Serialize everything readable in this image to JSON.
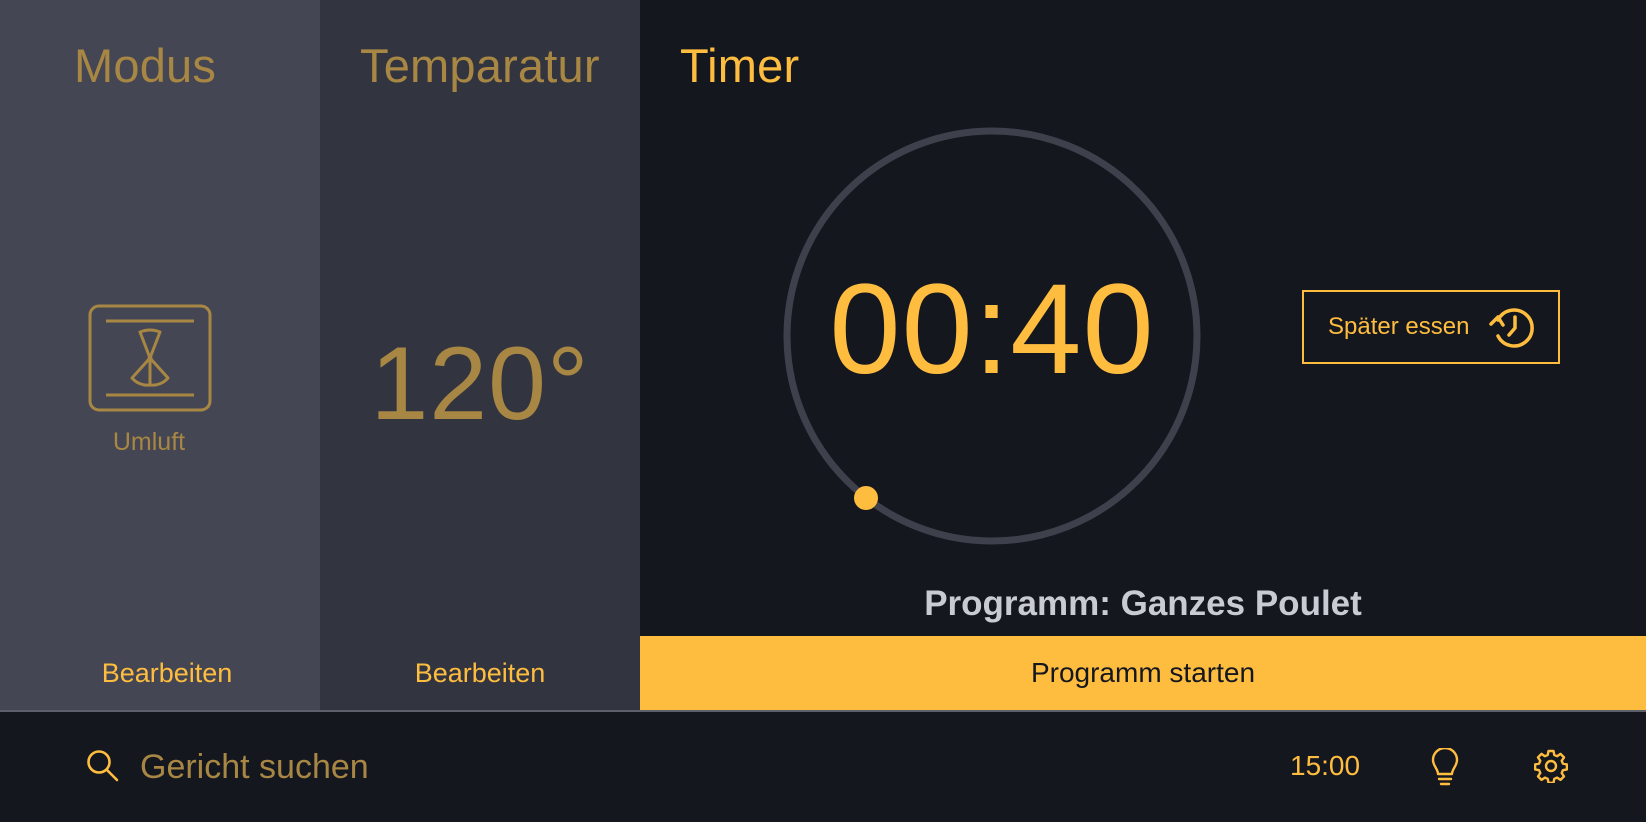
{
  "columns": {
    "mode": {
      "title": "Modus",
      "value_label": "Umluft",
      "icon": "convection-fan-icon",
      "edit_label": "Bearbeiten"
    },
    "temperature": {
      "title": "Temparatur",
      "value": "120°",
      "edit_label": "Bearbeiten"
    },
    "timer": {
      "title": "Timer",
      "value": "00:40",
      "later_label": "Später essen",
      "later_icon": "history-clock-icon",
      "program": "Programm: Ganzes Poulet",
      "start_label": "Programm starten"
    }
  },
  "bottom_bar": {
    "search_placeholder": "Gericht suchen",
    "clock": "15:00",
    "icons": [
      "search-icon",
      "lightbulb-icon",
      "gear-icon"
    ]
  },
  "colors": {
    "accent": "#ffbd3f",
    "muted_gold": "#a88643",
    "bg_dark": "#15171f",
    "panel_mode": "#444753",
    "panel_temp": "#323540",
    "ring": "#3e404b"
  }
}
